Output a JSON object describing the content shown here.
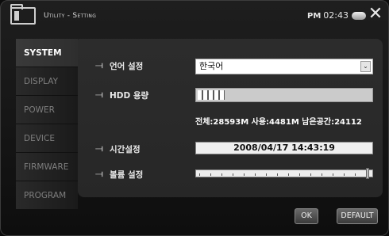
{
  "header": {
    "title": "Utility - Setting",
    "ampm": "PM",
    "time": "02:43"
  },
  "sidebar": {
    "items": [
      {
        "label": "SYSTEM",
        "active": true
      },
      {
        "label": "DISPLAY",
        "active": false
      },
      {
        "label": "POWER",
        "active": false
      },
      {
        "label": "DEVICE",
        "active": false
      },
      {
        "label": "FIRMWARE",
        "active": false
      },
      {
        "label": "PROGRAM",
        "active": false
      }
    ]
  },
  "settings": {
    "language": {
      "label": "언어 설정",
      "value": "한국어"
    },
    "hdd": {
      "label": "HDD 용량",
      "usage_fraction": 0.157,
      "info": "전체:28593M 사용:4481M 남은공간:24112"
    },
    "datetime": {
      "label": "시간설정",
      "value": "2008/04/17 14:43:19"
    },
    "volume": {
      "label": "볼륨 설정",
      "level_fraction": 0.98
    }
  },
  "buttons": {
    "ok": "OK",
    "default": "DEFAULT"
  },
  "icons": {
    "header_left": "folder-icon",
    "battery": "battery-icon",
    "close": "close-icon",
    "row": "plug-icon"
  }
}
